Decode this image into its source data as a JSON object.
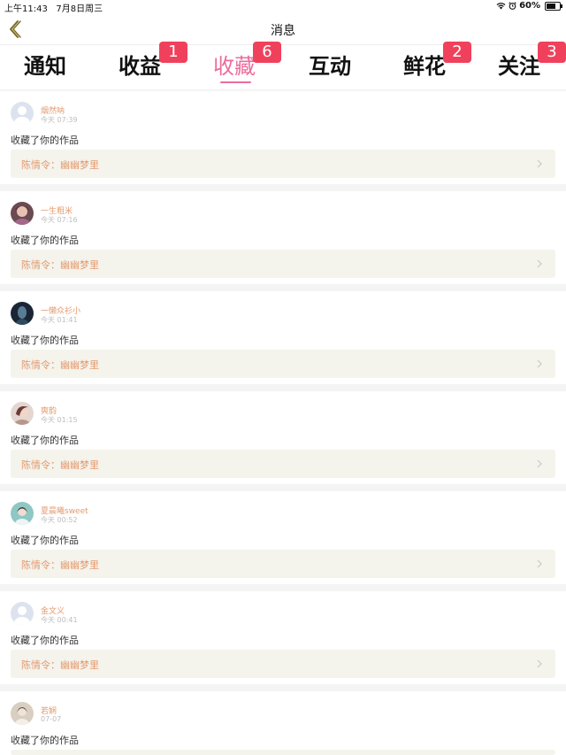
{
  "status_bar": {
    "time": "上午11:43",
    "date": "7月8日周三",
    "battery": "60%",
    "icons": [
      "wifi-icon",
      "alarm-icon",
      "battery-icon"
    ]
  },
  "header": {
    "title": "消息",
    "back_icon": "chevron-left-icon"
  },
  "tabs": [
    {
      "label": "通知",
      "badge": ""
    },
    {
      "label": "收益",
      "badge": "1"
    },
    {
      "label": "收藏",
      "badge": "6",
      "active": true
    },
    {
      "label": "互动",
      "badge": ""
    },
    {
      "label": "鲜花",
      "badge": "2"
    },
    {
      "label": "关注",
      "badge": "3"
    }
  ],
  "notifications": [
    {
      "username": "烟然呐",
      "time": "今天 07:39",
      "action": "收藏了你的作品",
      "work": "陈情令：幽幽梦里"
    },
    {
      "username": "一生粗米",
      "time": "今天 07:16",
      "action": "收藏了你的作品",
      "work": "陈情令：幽幽梦里"
    },
    {
      "username": "一懒众衫小",
      "time": "今天 01:41",
      "action": "收藏了你的作品",
      "work": "陈情令：幽幽梦里"
    },
    {
      "username": "奭韵",
      "time": "今天 01:15",
      "action": "收藏了你的作品",
      "work": "陈情令：幽幽梦里"
    },
    {
      "username": "夏晨曦sweet",
      "time": "今天 00:52",
      "action": "收藏了你的作品",
      "work": "陈情令：幽幽梦里"
    },
    {
      "username": "金文义",
      "time": "今天 00:41",
      "action": "收藏了你的作品",
      "work": "陈情令：幽幽梦里"
    },
    {
      "username": "若娴",
      "time": "07-07",
      "action": "收藏了你的作品",
      "work": ""
    }
  ],
  "colors": {
    "accent": "#ec6c9c",
    "badge": "#f0415c",
    "username": "#e39b70",
    "link_bg": "#f4f3ec"
  }
}
